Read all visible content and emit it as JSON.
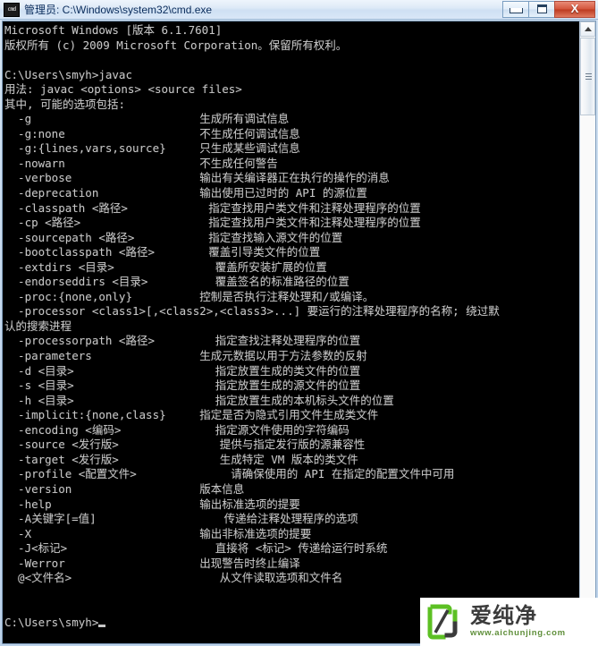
{
  "window": {
    "title": "管理员: C:\\Windows\\system32\\cmd.exe",
    "system_icon_label": "cmd",
    "buttons": {
      "minimize": "Minimize",
      "maximize": "Restore",
      "close": "X"
    }
  },
  "scrollbar": {
    "up_arrow": "▲",
    "down_arrow": "▼",
    "orientation": "vertical"
  },
  "console": {
    "background": "#000000",
    "foreground": "#c6c6c6",
    "lines": [
      "Microsoft Windows [版本 6.1.7601]",
      "版权所有 (c) 2009 Microsoft Corporation。保留所有权利。",
      "",
      "C:\\Users\\smyh>javac",
      "用法: javac <options> <source files>",
      "其中, 可能的选项包括:",
      "  -g                         生成所有调试信息",
      "  -g:none                    不生成任何调试信息",
      "  -g:{lines,vars,source}     只生成某些调试信息",
      "  -nowarn                    不生成任何警告",
      "  -verbose                   输出有关编译器正在执行的操作的消息",
      "  -deprecation               输出使用已过时的 API 的源位置",
      "  -classpath <路径>            指定查找用户类文件和注释处理程序的位置",
      "  -cp <路径>                   指定查找用户类文件和注释处理程序的位置",
      "  -sourcepath <路径>           指定查找输入源文件的位置",
      "  -bootclasspath <路径>        覆盖引导类文件的位置",
      "  -extdirs <目录>               覆盖所安装扩展的位置",
      "  -endorseddirs <目录>          覆盖签名的标准路径的位置",
      "  -proc:{none,only}          控制是否执行注释处理和/或编译。",
      "  -processor <class1>[,<class2>,<class3>...] 要运行的注释处理程序的名称; 绕过默",
      "认的搜索进程",
      "  -processorpath <路径>         指定查找注释处理程序的位置",
      "  -parameters                生成元数据以用于方法参数的反射",
      "  -d <目录>                     指定放置生成的类文件的位置",
      "  -s <目录>                     指定放置生成的源文件的位置",
      "  -h <目录>                     指定放置生成的本机标头文件的位置",
      "  -implicit:{none,class}     指定是否为隐式引用文件生成类文件",
      "  -encoding <编码>              指定源文件使用的字符编码",
      "  -source <发行版>               提供与指定发行版的源兼容性",
      "  -target <发行版>               生成特定 VM 版本的类文件",
      "  -profile <配置文件>              请确保使用的 API 在指定的配置文件中可用",
      "  -version                   版本信息",
      "  -help                      输出标准选项的提要",
      "  -A关键字[=值]                   传递给注释处理程序的选项",
      "  -X                         输出非标准选项的提要",
      "  -J<标记>                      直接将 <标记> 传递给运行时系统",
      "  -Werror                    出现警告时终止编译",
      "  @<文件名>                      从文件读取选项和文件名",
      "",
      ""
    ],
    "prompt": "C:\\Users\\smyh>",
    "cursor": "_"
  },
  "watermark": {
    "brand_cn": "爱纯净",
    "url": "www.aichunjing.com",
    "logo_color": "#5cc023",
    "logo_dark": "#3b3b3b"
  }
}
